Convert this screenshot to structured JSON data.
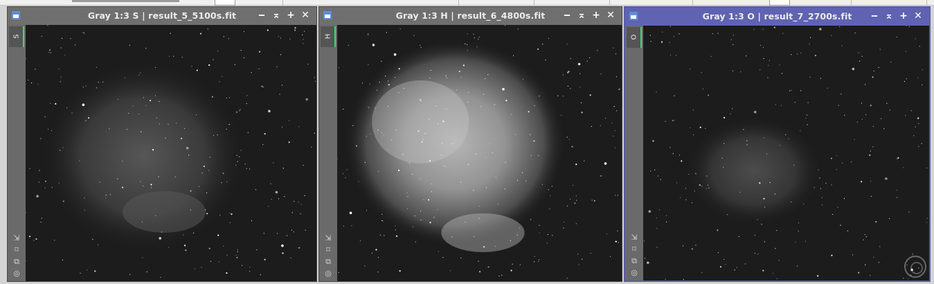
{
  "windows": [
    {
      "title": "Gray 1:3 S | result_5_5100s.fit",
      "tab_label": "S",
      "active": false
    },
    {
      "title": "Gray 1:3 H | result_6_4800s.fit",
      "tab_label": "H",
      "active": true
    },
    {
      "title": "Gray 1:3 O | result_7_2700s.fit",
      "tab_label": "O",
      "active": true
    }
  ],
  "controls": {
    "minimize": "‒",
    "shade": "⌅",
    "maximize": "+",
    "close": "✕"
  },
  "side_icons": [
    "resize-icon",
    "fit-view-icon",
    "clone-icon",
    "target-icon"
  ],
  "colors": {
    "active_title": "#5f63b2",
    "inactive_title": "#6f6f6f",
    "tab_accent": "#3fdc6a"
  }
}
